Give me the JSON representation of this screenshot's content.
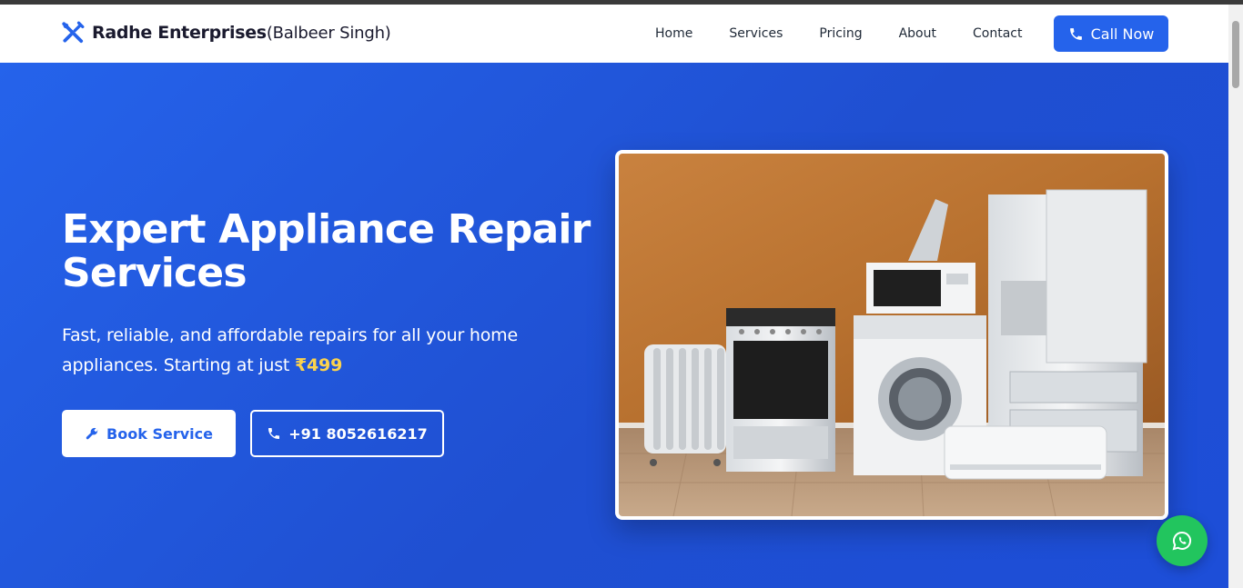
{
  "header": {
    "brand_name": "Radhe Enterprises",
    "brand_owner": "(Balbeer Singh)",
    "nav": [
      {
        "label": "Home"
      },
      {
        "label": "Services"
      },
      {
        "label": "Pricing"
      },
      {
        "label": "About"
      },
      {
        "label": "Contact"
      }
    ],
    "call_label": "Call Now"
  },
  "hero": {
    "title": "Expert Appliance Repair Services",
    "text": "Fast, reliable, and affordable repairs for all your home appliances. Starting at just",
    "price": "₹499",
    "book_label": "Book Service",
    "phone_label": "+91 8052616217"
  },
  "icons": {
    "brand": "tools-icon",
    "call": "phone-icon",
    "book": "wrench-icon",
    "whatsapp": "whatsapp-icon"
  },
  "colors": {
    "primary": "#2563eb",
    "accent_price": "#fcd34d",
    "whatsapp": "#22c55e"
  }
}
